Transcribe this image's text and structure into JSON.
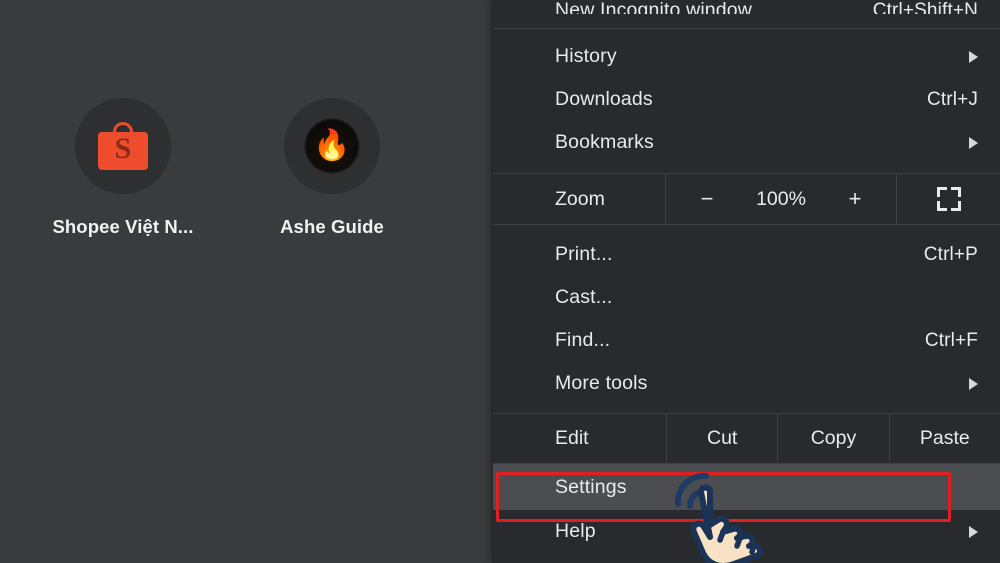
{
  "desktop": {
    "background_color": "#3a3b3d",
    "shortcuts": [
      {
        "label": "Shopee Việt N...",
        "icon": "shopee-bag-icon",
        "accent": "#ee4d2d"
      },
      {
        "label": "Ashe Guide",
        "icon": "flame-icon",
        "glyph": "🔥",
        "accent": "#f5a623"
      }
    ]
  },
  "menu": {
    "background_color": "#292a2d",
    "text_color": "#e8eaed",
    "items": [
      {
        "label": "New Incognito window",
        "accel": "Ctrl+Shift+N",
        "submenu": false,
        "clipped": true
      },
      {
        "label": "History",
        "accel": "",
        "submenu": true
      },
      {
        "label": "Downloads",
        "accel": "Ctrl+J",
        "submenu": false
      },
      {
        "label": "Bookmarks",
        "accel": "",
        "submenu": true
      }
    ],
    "zoom": {
      "label": "Zoom",
      "minus_label": "−",
      "level": "100%",
      "plus_label": "+",
      "fullscreen_icon": "fullscreen-icon"
    },
    "items2": [
      {
        "label": "Print...",
        "accel": "Ctrl+P",
        "submenu": false
      },
      {
        "label": "Cast...",
        "accel": "",
        "submenu": false
      },
      {
        "label": "Find...",
        "accel": "Ctrl+F",
        "submenu": false
      },
      {
        "label": "More tools",
        "accel": "",
        "submenu": true
      }
    ],
    "edit_row": {
      "label": "Edit",
      "buttons": [
        "Cut",
        "Copy",
        "Paste"
      ]
    },
    "settings": {
      "label": "Settings",
      "highlighted": true,
      "highlight_color": "#4c4d50"
    },
    "help": {
      "label": "Help",
      "submenu": true
    }
  },
  "annotation": {
    "highlight_box_color": "#e02020",
    "cursor": "pointing-hand-cursor"
  }
}
